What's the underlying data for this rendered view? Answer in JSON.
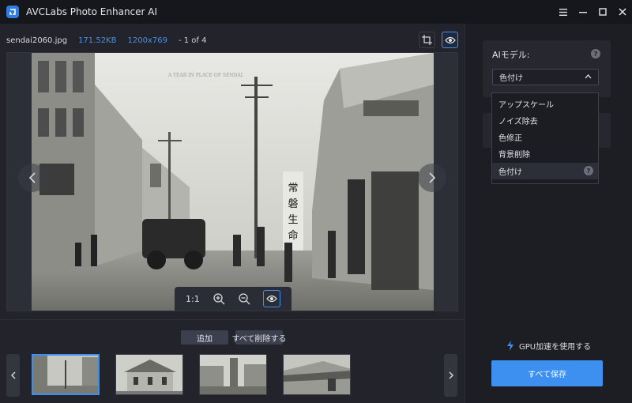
{
  "app": {
    "title": "AVCLabs Photo Enhancer AI"
  },
  "file": {
    "name": "sendai2060.jpg",
    "size": "171.52KB",
    "dimensions": "1200x769",
    "page": "- 1 of 4"
  },
  "zoom": {
    "ratio": "1:1"
  },
  "actions": {
    "add": "追加",
    "delete_all": "すべて削除する"
  },
  "model": {
    "label": "AIモデル:",
    "selected": "色付け"
  },
  "dropdown": {
    "options": [
      "アップスケール",
      "ノイズ除去",
      "色修正",
      "背景削除",
      "色付け"
    ],
    "highlighted": "色付け"
  },
  "gpu": {
    "label": "GPU加速を使用する"
  },
  "save": {
    "label": "すべて保存"
  },
  "photo": {
    "top_caption": "A YEAR IN PLACE OF SENDAI",
    "sign_vertical": "常磐生命"
  },
  "colors": {
    "accent": "#3d8ff0",
    "background": "#1d1e25"
  },
  "icons": {
    "logo": "app-logo-icon",
    "menu": "hamburger-icon",
    "minimize": "minimize-icon",
    "maximize": "maximize-icon",
    "close": "close-icon",
    "crop": "crop-icon",
    "compare": "eye-icon",
    "zoom_in": "zoom-in-icon",
    "zoom_out": "zoom-out-icon",
    "gpu": "lightning-icon"
  }
}
